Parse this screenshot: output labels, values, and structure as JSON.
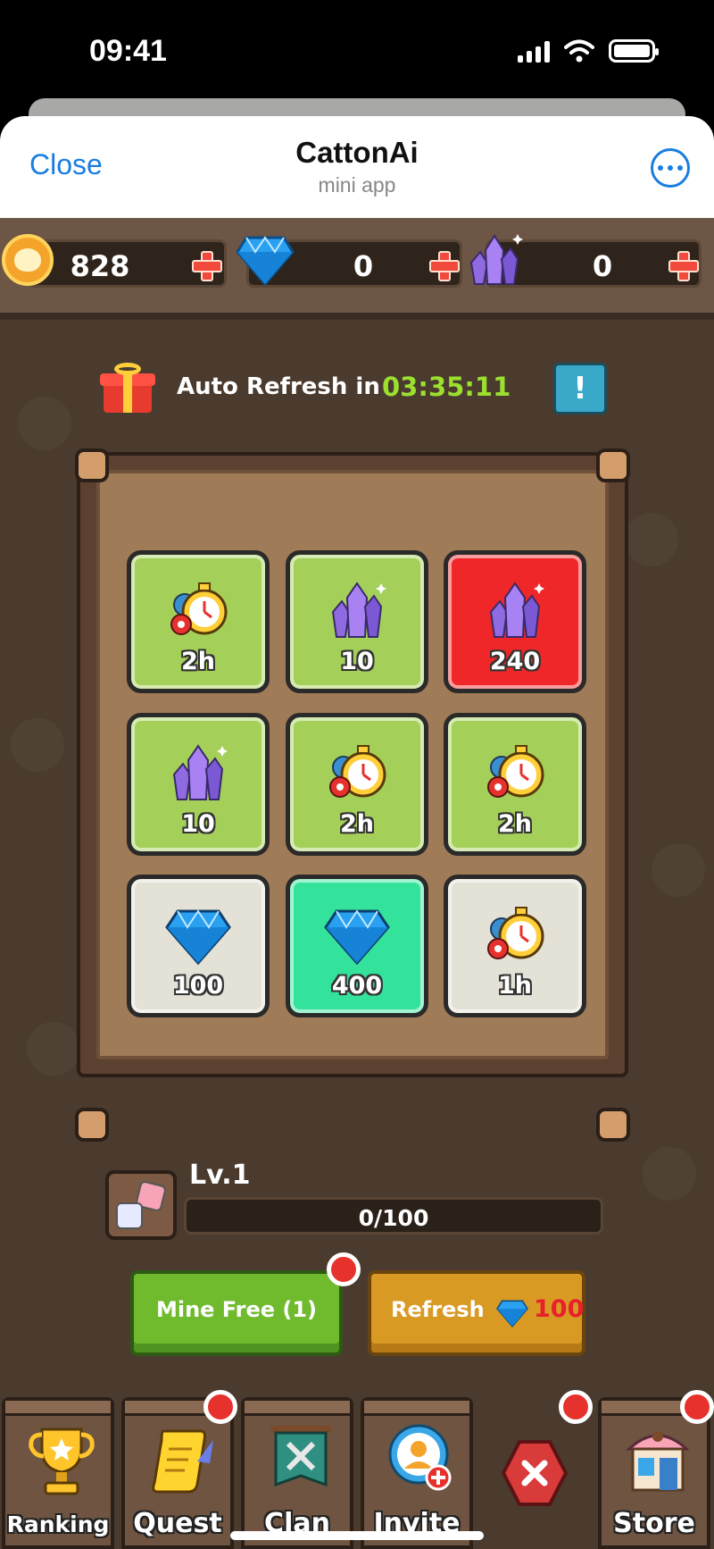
{
  "status_bar": {
    "time": "09:41"
  },
  "header": {
    "close_label": "Close",
    "title": "CattonAi",
    "subtitle": "mini app",
    "more_icon": "ellipsis-icon"
  },
  "currencies": [
    {
      "name": "cat-coin",
      "value": "828"
    },
    {
      "name": "diamond",
      "value": "0"
    },
    {
      "name": "crystal",
      "value": "0"
    }
  ],
  "refresh": {
    "label": "Auto Refresh in",
    "timer": "03:35:11",
    "info_label": "!"
  },
  "tiles": [
    {
      "icon": "stopwatch-icon",
      "label": "2h",
      "color": "green"
    },
    {
      "icon": "crystal-icon",
      "label": "10",
      "color": "green"
    },
    {
      "icon": "crystal-icon",
      "label": "240",
      "color": "red"
    },
    {
      "icon": "crystal-icon",
      "label": "10",
      "color": "green"
    },
    {
      "icon": "stopwatch-icon",
      "label": "2h",
      "color": "green"
    },
    {
      "icon": "stopwatch-icon",
      "label": "2h",
      "color": "green"
    },
    {
      "icon": "diamond-icon",
      "label": "100",
      "color": "gray"
    },
    {
      "icon": "diamond-icon",
      "label": "400",
      "color": "teal"
    },
    {
      "icon": "stopwatch-icon",
      "label": "1h",
      "color": "gray"
    }
  ],
  "level": {
    "label": "Lv.1",
    "progress_text": "0/100",
    "progress_fraction": 0.0
  },
  "actions": {
    "mine_label": "Mine Free (1)",
    "refresh_label": "Refresh",
    "refresh_cost": "100"
  },
  "nav": [
    {
      "label": "Ranking",
      "icon": "trophy-icon",
      "badge": false
    },
    {
      "label": "Quest",
      "icon": "scroll-icon",
      "badge": true
    },
    {
      "label": "Clan",
      "icon": "banner-icon",
      "badge": false
    },
    {
      "label": "Invite",
      "icon": "add-user-icon",
      "badge": false
    },
    {
      "label": "",
      "icon": "close-icon",
      "badge": true
    },
    {
      "label": "Store",
      "icon": "shop-icon",
      "badge": true
    }
  ],
  "colors": {
    "accent_blue": "#1a7ee0",
    "timer_green": "#9be02f",
    "cost_red": "#e8202b"
  }
}
